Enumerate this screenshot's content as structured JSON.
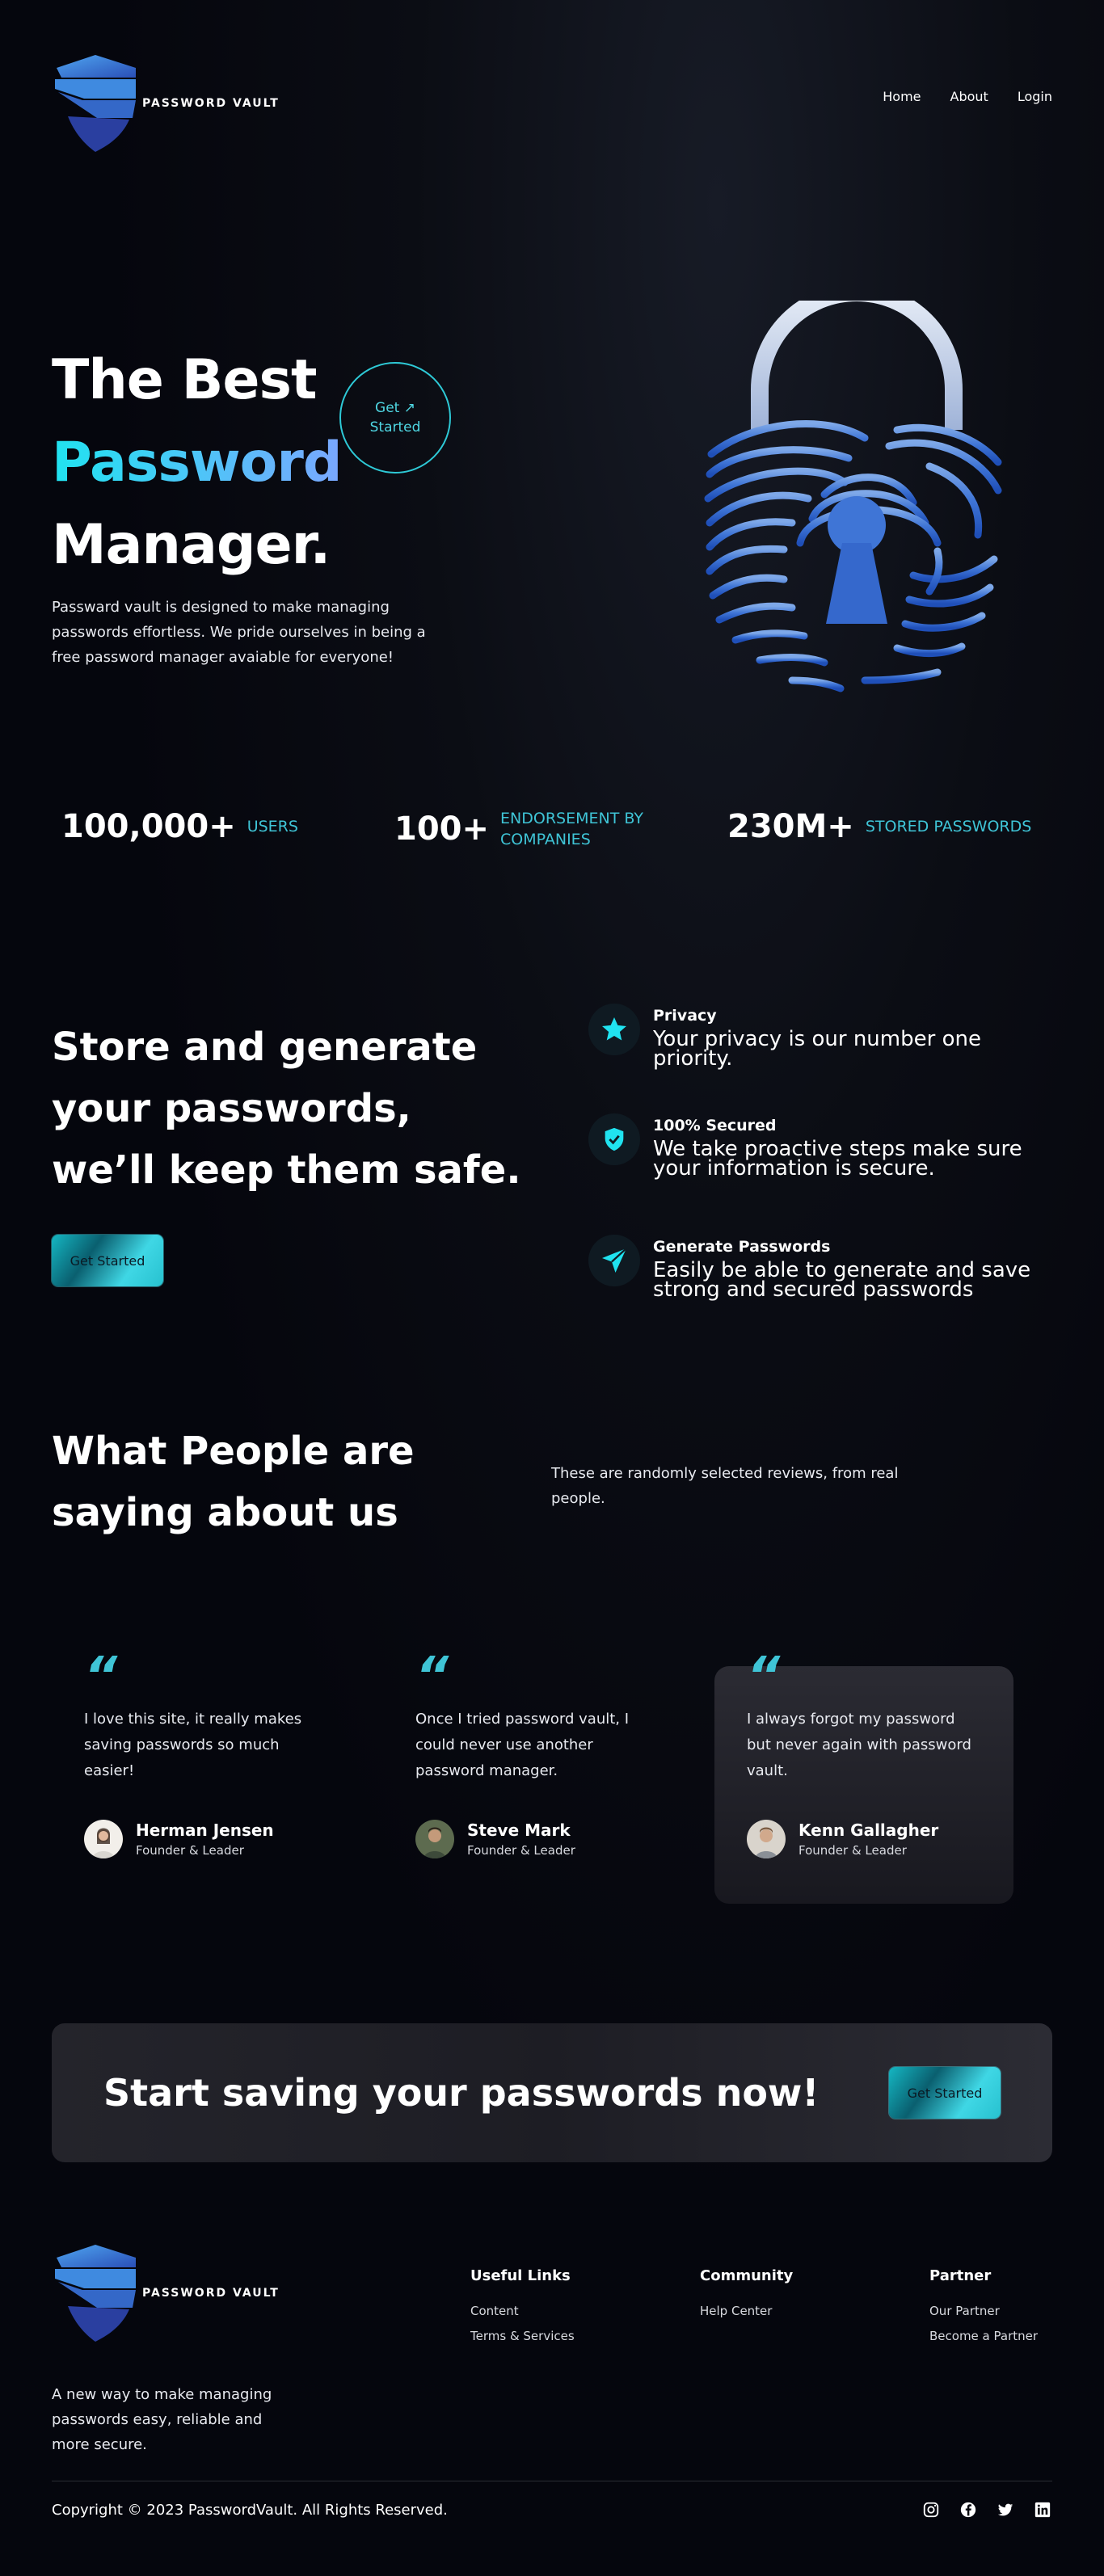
{
  "brand": {
    "name": "PASSWORD VAULT",
    "colors": {
      "accent": "#3fc4d6",
      "cyan": "#20e3f0",
      "blue": "#3a6fd0",
      "background": "#05060d"
    }
  },
  "nav": {
    "items": [
      {
        "label": "Home"
      },
      {
        "label": "About"
      },
      {
        "label": "Login"
      }
    ]
  },
  "hero": {
    "title_line1": "The Best",
    "title_line2": "Password",
    "title_line3": "Manager.",
    "cta_label": "Get ↗ Started",
    "description": "Passward vault is designed to make managing passwords effortless. We pride ourselves in being a free password manager avaiable for everyone!"
  },
  "stats": [
    {
      "number": "100,000+",
      "label": "USERS"
    },
    {
      "number": "100+",
      "label": "ENDORSEMENT BY COMPANIES"
    },
    {
      "number": "230M+",
      "label": "STORED PASSWORDS"
    }
  ],
  "features": {
    "title_line1": "Store and generate your passwords,",
    "title_line2": "we’ll keep them safe.",
    "button_label": "Get Started",
    "items": [
      {
        "icon": "star-icon",
        "title": "Privacy",
        "text": "Your privacy is our number one priority."
      },
      {
        "icon": "shield-check-icon",
        "title": "100% Secured",
        "text": "We take proactive steps make sure your information is secure."
      },
      {
        "icon": "send-icon",
        "title": "Generate Passwords",
        "text": "Easily be able to generate and save strong and secured passwords"
      }
    ]
  },
  "reviews": {
    "title": "What People are saying about us",
    "subtitle": "These are randomly selected reviews, from real people.",
    "items": [
      {
        "quote": "I love this site, it really makes saving passwords so much easier!",
        "name": "Herman Jensen",
        "role": "Founder & Leader"
      },
      {
        "quote": "Once I tried password vault, I could never use another password manager.",
        "name": "Steve Mark",
        "role": "Founder & Leader"
      },
      {
        "quote": "I always forgot my password but never again with password vault.",
        "name": "Kenn Gallagher",
        "role": "Founder & Leader"
      }
    ]
  },
  "banner": {
    "title": "Start saving your passwords now!",
    "button_label": "Get Started"
  },
  "footer": {
    "description": "A new way to make managing passwords easy, reliable and more secure.",
    "columns": [
      {
        "title": "Useful Links",
        "links": [
          "Content",
          "Terms & Services"
        ]
      },
      {
        "title": "Community",
        "links": [
          "Help Center"
        ]
      },
      {
        "title": "Partner",
        "links": [
          "Our Partner",
          "Become a Partner"
        ]
      }
    ],
    "copyright": "Copyright © 2023 PasswordVault. All Rights Reserved.",
    "socials": [
      "instagram-icon",
      "facebook-icon",
      "twitter-icon",
      "linkedin-icon"
    ]
  }
}
